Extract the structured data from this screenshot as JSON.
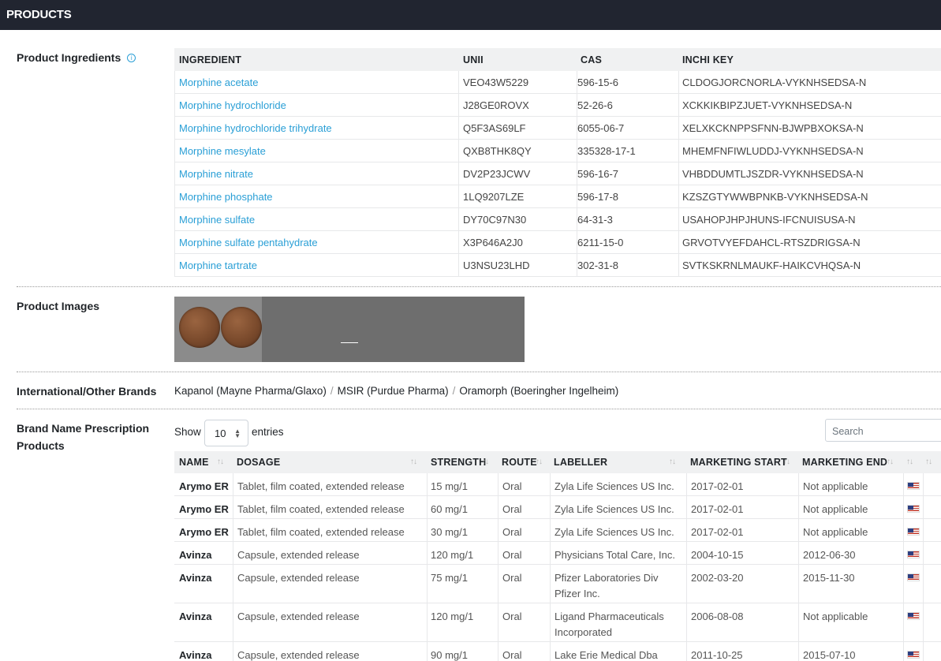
{
  "header": {
    "title": "PRODUCTS"
  },
  "ingredients": {
    "label": "Product Ingredients",
    "info_icon": "info-circle-icon",
    "columns": [
      "INGREDIENT",
      "UNII",
      "CAS",
      "INCHI KEY"
    ],
    "rows": [
      {
        "name": "Morphine acetate",
        "unii": "VEO43W5229",
        "cas": "596-15-6",
        "inchi": "CLDOGJORCNORLA-VYKNHSEDSA-N"
      },
      {
        "name": "Morphine hydrochloride",
        "unii": "J28GE0ROVX",
        "cas": "52-26-6",
        "inchi": "XCKKIKBIPZJUET-VYKNHSEDSA-N"
      },
      {
        "name": "Morphine hydrochloride trihydrate",
        "unii": "Q5F3AS69LF",
        "cas": "6055-06-7",
        "inchi": "XELXKCKNPPSFNN-BJWPBXOKSA-N"
      },
      {
        "name": "Morphine mesylate",
        "unii": "QXB8THK8QY",
        "cas": "335328-17-1",
        "inchi": "MHEMFNFIWLUDDJ-VYKNHSEDSA-N"
      },
      {
        "name": "Morphine nitrate",
        "unii": "DV2P23JCWV",
        "cas": "596-16-7",
        "inchi": "VHBDDUMTLJSZDR-VYKNHSEDSA-N"
      },
      {
        "name": "Morphine phosphate",
        "unii": "1LQ9207LZE",
        "cas": "596-17-8",
        "inchi": "KZSZGTYWWBPNKB-VYKNHSEDSA-N"
      },
      {
        "name": "Morphine sulfate",
        "unii": "DY70C97N30",
        "cas": "64-31-3",
        "inchi": "USAHOPJHPJHUNS-IFCNUISUSA-N"
      },
      {
        "name": "Morphine sulfate pentahydrate",
        "unii": "X3P646A2J0",
        "cas": "6211-15-0",
        "inchi": "GRVOTVYEFDAHCL-RTSZDRIGSA-N"
      },
      {
        "name": "Morphine tartrate",
        "unii": "U3NSU23LHD",
        "cas": "302-31-8",
        "inchi": "SVTKSKRNLMAUKF-HAIKCVHQSA-N"
      }
    ]
  },
  "images": {
    "label": "Product Images"
  },
  "brands": {
    "label": "International/Other Brands",
    "items": [
      "Kapanol (Mayne Pharma/Glaxo)",
      "MSIR (Purdue Pharma)",
      "Oramorph (Boeringher Ingelheim)"
    ]
  },
  "rx": {
    "label_line1": "Brand Name Prescription",
    "label_line2": "Products",
    "show_label": "Show",
    "entries_value": "10",
    "entries_label": "entries",
    "search_placeholder": "Search",
    "columns": [
      "NAME",
      "DOSAGE",
      "STRENGTH",
      "ROUTE",
      "LABELLER",
      "MARKETING START",
      "MARKETING END"
    ],
    "flag_icon": "us-flag-icon",
    "rows": [
      {
        "name": "Arymo ER",
        "dosage": "Tablet, film coated, extended release",
        "strength": "15 mg/1",
        "route": "Oral",
        "labeller": "Zyla Life Sciences US Inc.",
        "start": "2017-02-01",
        "end": "Not applicable"
      },
      {
        "name": "Arymo ER",
        "dosage": "Tablet, film coated, extended release",
        "strength": "60 mg/1",
        "route": "Oral",
        "labeller": "Zyla Life Sciences US Inc.",
        "start": "2017-02-01",
        "end": "Not applicable"
      },
      {
        "name": "Arymo ER",
        "dosage": "Tablet, film coated, extended release",
        "strength": "30 mg/1",
        "route": "Oral",
        "labeller": "Zyla Life Sciences US Inc.",
        "start": "2017-02-01",
        "end": "Not applicable"
      },
      {
        "name": "Avinza",
        "dosage": "Capsule, extended release",
        "strength": "120 mg/1",
        "route": "Oral",
        "labeller": "Physicians Total Care, Inc.",
        "start": "2004-10-15",
        "end": "2012-06-30"
      },
      {
        "name": "Avinza",
        "dosage": "Capsule, extended release",
        "strength": "75 mg/1",
        "route": "Oral",
        "labeller": "Pfizer Laboratories Div Pfizer Inc.",
        "start": "2002-03-20",
        "end": "2015-11-30"
      },
      {
        "name": "Avinza",
        "dosage": "Capsule, extended release",
        "strength": "120 mg/1",
        "route": "Oral",
        "labeller": "Ligand Pharmaceuticals Incorporated",
        "start": "2006-08-08",
        "end": "Not applicable"
      },
      {
        "name": "Avinza",
        "dosage": "Capsule, extended release",
        "strength": "90 mg/1",
        "route": "Oral",
        "labeller": "Lake Erie Medical Dba",
        "start": "2011-10-25",
        "end": "2015-07-10"
      }
    ]
  }
}
